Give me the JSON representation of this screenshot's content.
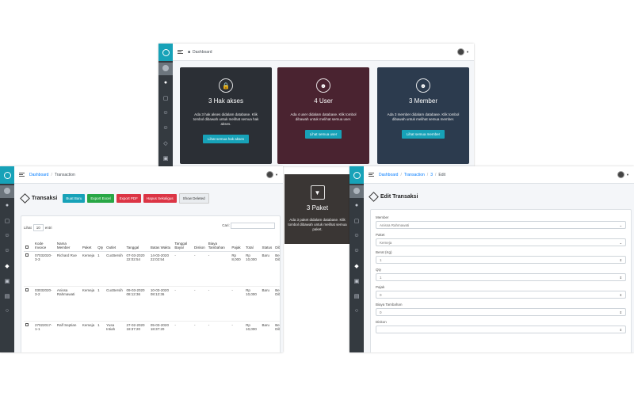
{
  "dashboard": {
    "breadcrumb": "Dashboard",
    "cards": [
      {
        "title": "3 Hak akses",
        "desc": "Ada 3 hak akses didalam database. Klik tombol dibawah untuk melihat semua hak akses.",
        "button": "Lihat semua hak akses",
        "icon": "lock-icon",
        "color": "#2b2f35"
      },
      {
        "title": "4 User",
        "desc": "Ada 4 user didalam database. Klik tombol dibawah untuk melihat semua user.",
        "button": "Lihat semua user",
        "icon": "users-icon",
        "color": "#4a2330"
      },
      {
        "title": "3 Member",
        "desc": "Ada 3 member didalam database. Klik tombol dibawah untuk melihat semua member.",
        "button": "Lihat semua member",
        "icon": "member-icon",
        "color": "#2c3b4e"
      }
    ]
  },
  "paket_card": {
    "title": "3 Paket",
    "desc": "Ada 3 paket didalam database. Klik tombol dibawah untuk melihat semua paket."
  },
  "transaksi": {
    "breadcrumb": [
      "Dashboard",
      "Transaction"
    ],
    "title": "Transaksi",
    "buttons": [
      {
        "label": "Buat Baru",
        "color": "#17a2b8"
      },
      {
        "label": "Export Excel",
        "color": "#28a745"
      },
      {
        "label": "Export PDF",
        "color": "#dc3545"
      },
      {
        "label": "Hapus Sekaligus",
        "color": "#dc3545"
      }
    ],
    "show_deleted": "Show Deleted",
    "length_label_pre": "Lihat",
    "length_value": "10",
    "length_label_post": "entri",
    "search_label": "Cari:",
    "columns": [
      "",
      "Kode Invoice",
      "Nama Member",
      "Paket",
      "Qty",
      "Outlet",
      "Tanggal",
      "Batas Waktu",
      "Tanggal Bayar",
      "Diskon",
      "Biaya Tambahan",
      "Pajak",
      "Total",
      "Status",
      "Dibayar"
    ],
    "rows": [
      [
        "",
        "07032020-3-3",
        "Richard Roe",
        "Kemeja",
        "1",
        "CucBersih",
        "07-03-2020 22:02:54",
        "14-03-2020 22:02:54",
        "-",
        "-",
        "-",
        "Rp 8,000",
        "Rp 10,000",
        "Baru",
        "Belum Dibayar"
      ],
      [
        "",
        "03032020-3-2",
        "Anissa Rahmawati",
        "Kemeja",
        "1",
        "CucBersih",
        "09-03-2020 08:12:36",
        "10-03-2020 08:12:36",
        "-",
        "-",
        "-",
        "-",
        "Rp 10,000",
        "Baru",
        "Belum Dibayar"
      ],
      [
        "",
        "27022017-1-1",
        "Ralf Septian",
        "Kemeja",
        "1",
        "Yusa Intiah",
        "27-02-2020 18:37:20",
        "05-03-2020 18:37:20",
        "-",
        "-",
        "-",
        "-",
        "Rp 10,000",
        "Baru",
        "Belum Dibayar"
      ]
    ]
  },
  "edit": {
    "breadcrumb": [
      "Dashboard",
      "Transaction",
      "3",
      "Edit"
    ],
    "title": "Edit Transaksi",
    "fields": [
      {
        "label": "Member",
        "value": "Anissa Rahmawati",
        "kind": "select"
      },
      {
        "label": "Paket",
        "value": "Kemeja",
        "kind": "select"
      },
      {
        "label": "Berat (Kg)",
        "value": "1",
        "kind": "number"
      },
      {
        "label": "Qty",
        "value": "1",
        "kind": "number"
      },
      {
        "label": "Pajak",
        "value": "0",
        "kind": "number"
      },
      {
        "label": "Biaya Tambahan",
        "value": "0",
        "kind": "number"
      },
      {
        "label": "Diskon",
        "value": "",
        "kind": "number"
      }
    ]
  }
}
